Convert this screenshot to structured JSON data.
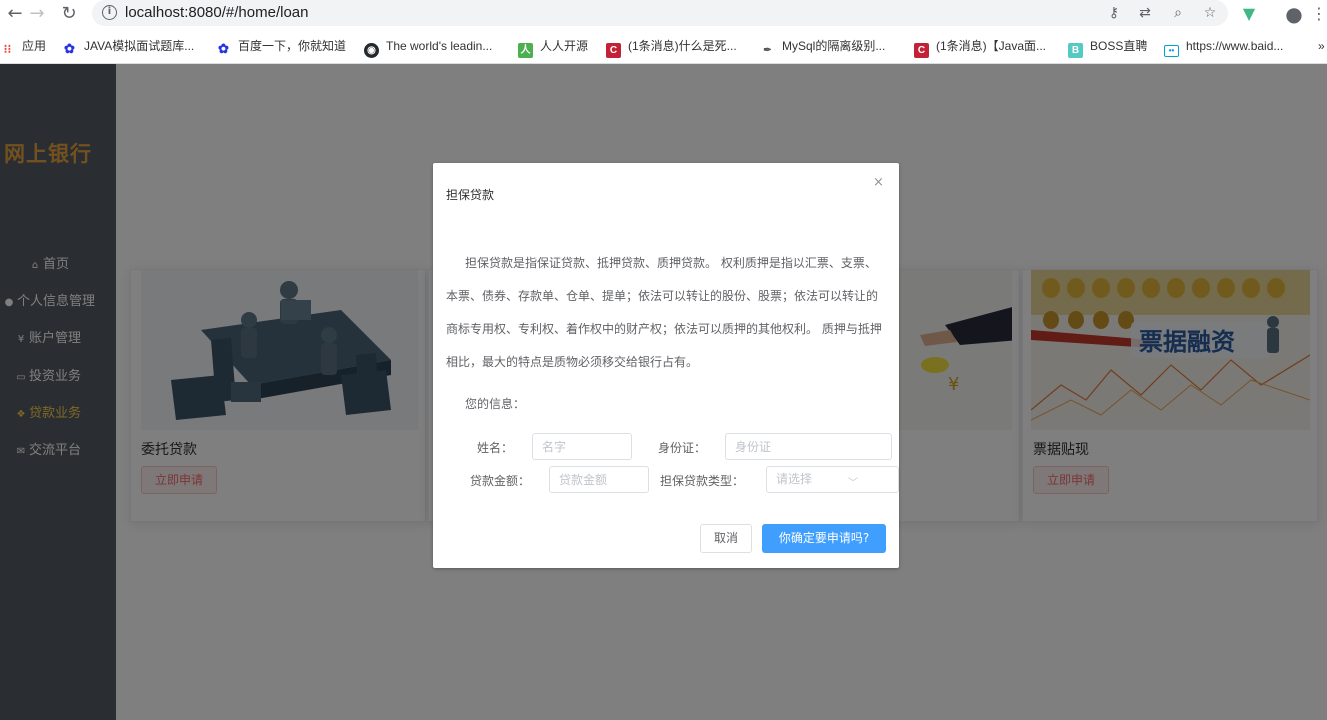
{
  "browser": {
    "url": "localhost:8080/#/home/loan",
    "bookmarks": [
      {
        "label": "应用",
        "icon": "apps-grid-icon",
        "color": "#4285f4"
      },
      {
        "label": "JAVA模拟面试题库...",
        "icon": "baidu-paw-icon",
        "color": "#2932e1"
      },
      {
        "label": "百度一下，你就知道",
        "icon": "baidu-paw-icon",
        "color": "#2932e1"
      },
      {
        "label": "The world's leadin...",
        "icon": "github-icon",
        "color": "#24292e"
      },
      {
        "label": "人人开源",
        "icon": "renren-icon",
        "color": "#4caf50"
      },
      {
        "label": "(1条消息)什么是死...",
        "icon": "csdn-icon",
        "color": "#c32136"
      },
      {
        "label": "MySql的隔离级别...",
        "icon": "quill-icon",
        "color": "#555555"
      },
      {
        "label": "(1条消息)【Java面...",
        "icon": "csdn-icon",
        "color": "#c32136"
      },
      {
        "label": "BOSS直聘",
        "icon": "boss-icon",
        "color": "#53cac3"
      },
      {
        "label": "https://www.baid...",
        "icon": "bilibili-icon",
        "color": "#00a1d6"
      }
    ],
    "more_glyph": "»"
  },
  "sidebar": {
    "brand": "网上银行",
    "items": [
      {
        "label": "首页",
        "glyph": "⌂"
      },
      {
        "label": "个人信息管理",
        "glyph": "●"
      },
      {
        "label": "账户管理",
        "glyph": "¥"
      },
      {
        "label": "投资业务",
        "glyph": "▭"
      },
      {
        "label": "贷款业务",
        "glyph": "❖"
      },
      {
        "label": "交流平台",
        "glyph": "✉"
      }
    ],
    "active": "贷款业务",
    "active_color": "#ffd04b"
  },
  "cards": [
    {
      "title": "委托贷款",
      "button": "立即申请"
    },
    {
      "title": "",
      "button": ""
    },
    {
      "title": "",
      "button": ""
    },
    {
      "title": "票据贴现",
      "button": "立即申请",
      "image_text": "票据融资"
    }
  ],
  "dialog": {
    "title": "担保贷款",
    "close": "×",
    "body_lines": [
      "担保贷款是指保证贷款、抵押贷款、质押贷款。 权利质押是指以汇票、支票、",
      "本票、债券、存款单、仓单、提单；依法可以转让的股份、股票；依法可以转让的",
      "商标专用权、专利权、着作权中的财产权；依法可以质押的其他权利。 质押与抵押",
      "相比，最大的特点是质物必须移交给银行占有。"
    ],
    "info_label": "您的信息：",
    "fields": {
      "name_label": "姓名：",
      "name_placeholder": "名字",
      "id_label": "身份证：",
      "id_placeholder": "身份证",
      "amount_label": "贷款金额：",
      "amount_placeholder": "贷款金额",
      "type_label": "担保贷款类型：",
      "type_placeholder": "请选择"
    },
    "cancel": "取消",
    "confirm": "你确定要申请吗?"
  },
  "colors": {
    "sidebar_bg": "#545c64",
    "brand": "#e6a23c",
    "primary": "#409eff",
    "danger": "#f56c6c"
  }
}
